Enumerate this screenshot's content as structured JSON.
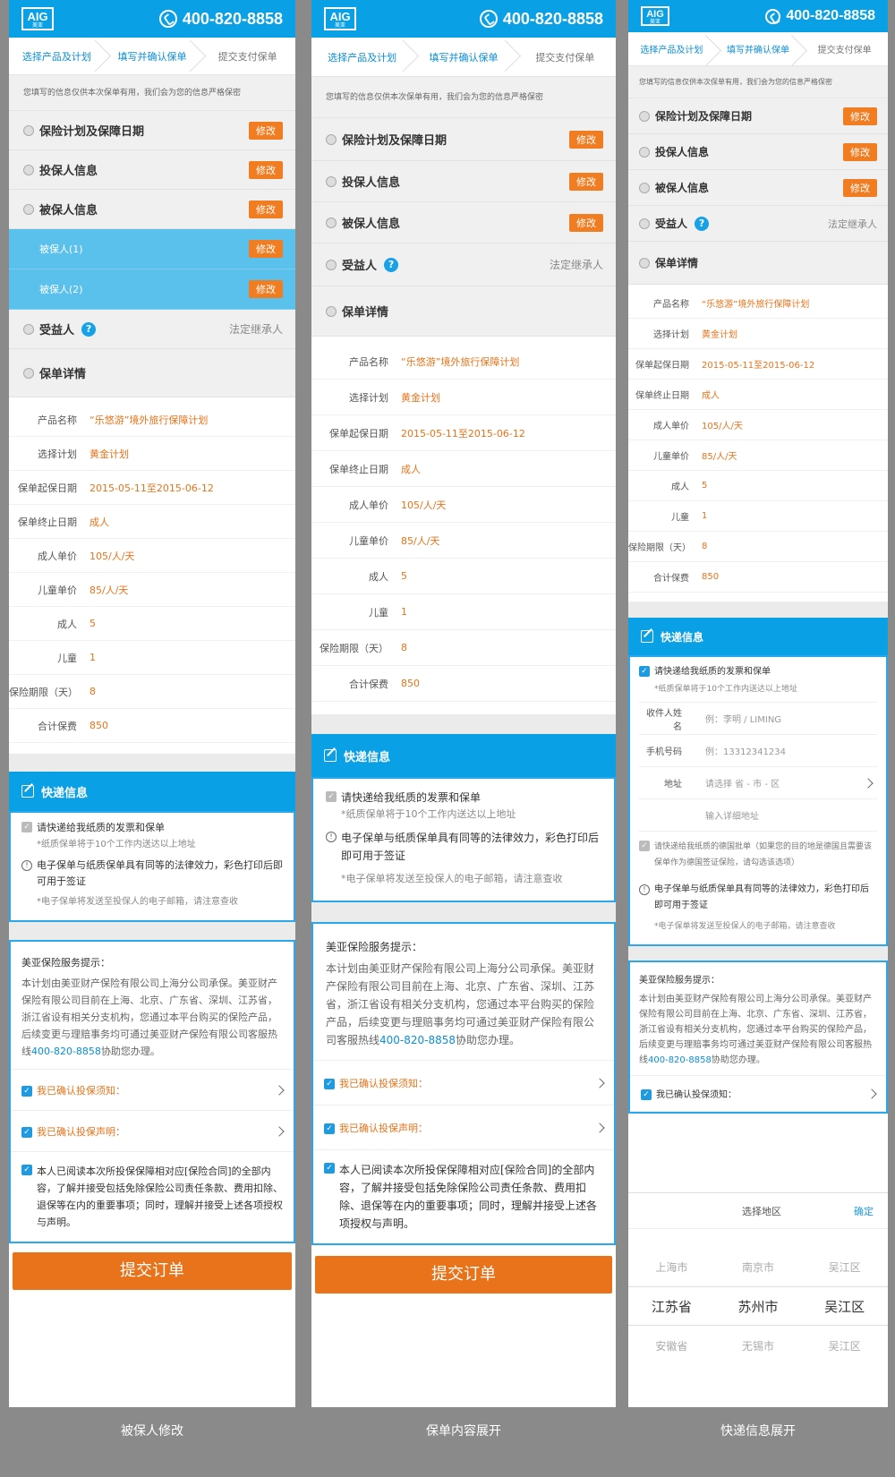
{
  "header": {
    "logo_text": "AIG",
    "logo_sub": "美亚",
    "phone": "400-820-8858"
  },
  "steps": [
    "选择产品及计划",
    "填写并确认保单",
    "提交支付保单"
  ],
  "notice": "您填写的信息仅供本次保单有用，我们会为您的信息严格保密",
  "sections": {
    "plan": "保险计划及保障日期",
    "holder": "投保人信息",
    "insured": "被保人信息",
    "beneficiary": "受益人",
    "beneficiary_value": "法定继承人",
    "details": "保单详情",
    "edit": "修改",
    "help": "?"
  },
  "insured_list": [
    "被保人(1)",
    "被保人(2)"
  ],
  "detail_rows": [
    {
      "label": "产品名称",
      "value": "“乐悠游”境外旅行保障计划"
    },
    {
      "label": "选择计划",
      "value": "黄金计划"
    },
    {
      "label": "保单起保日期",
      "value": "2015-05-11至2015-06-12"
    },
    {
      "label": "保单终止日期",
      "value": "成人"
    },
    {
      "label": "成人单价",
      "value": "105/人/天"
    },
    {
      "label": "儿童单价",
      "value": "85/人/天"
    },
    {
      "label": "成人",
      "value": "5"
    },
    {
      "label": "儿童",
      "value": "1"
    },
    {
      "label": "保险期限（天）",
      "value": "8"
    },
    {
      "label": "合计保费",
      "value": "850"
    }
  ],
  "express": {
    "title": "快递信息",
    "paper_check": "请快递给我纸质的发票和保单",
    "paper_hint": "*纸质保单将于10个工作内送达以上地址",
    "legal": "电子保单与纸质保单具有同等的法律效力，彩色打印后即可用于签证",
    "email_hint": "*电子保单将发送至投保人的电子邮箱，请注意查收",
    "name_label": "收件人姓名",
    "name_placeholder": "例：李明 / LIMING",
    "mobile_label": "手机号码",
    "mobile_placeholder": "例：13312341234",
    "addr_label": "地址",
    "addr_placeholder": "请选择 省 - 市 - 区",
    "addr_detail": "输入详细地址",
    "german": "请快递给我纸质的德国批单（如果您的目的地是德国且需要该保单作为德国签证保险，请勾选该选项）"
  },
  "service": {
    "title": "美亚保险服务提示：",
    "body_1": "本计划由美亚财产保险有限公司上海分公司承保。美亚财产保险有限公司目前在上海、北京、广东省、深圳、江苏省，浙江省设有相关分支机构，您通过本平台购买的保险产品，后续变更与理赔事务均可通过美亚财产保险有限公司客服热线",
    "hotline": "400-820-8858",
    "body_2": "协助您办理。",
    "confirm_notice": "我已确认投保须知：",
    "confirm_statement": "我已确认投保声明：",
    "agree": "本人已阅读本次所投保保障相对应[保险合同]的全部内容，了解并接受包括免除保险公司责任条款、费用扣除、退保等在内的重要事项；同时，理解并接受上述各项授权与声明。"
  },
  "submit": "提交订单",
  "picker": {
    "title": "选择地区",
    "ok": "确定",
    "rows": [
      [
        "上海市",
        "南京市",
        "吴江区"
      ],
      [
        "江苏省",
        "苏州市",
        "吴江区"
      ],
      [
        "安徽省",
        "无锡市",
        "吴江区"
      ]
    ]
  },
  "captions": [
    "被保人修改",
    "保单内容展开",
    "快递信息展开"
  ],
  "colors": {
    "brand_blue": "#0aa0e6",
    "orange": "#e8731a",
    "edit_orange": "#f07d22",
    "insured_blue": "#5ac0ec"
  }
}
